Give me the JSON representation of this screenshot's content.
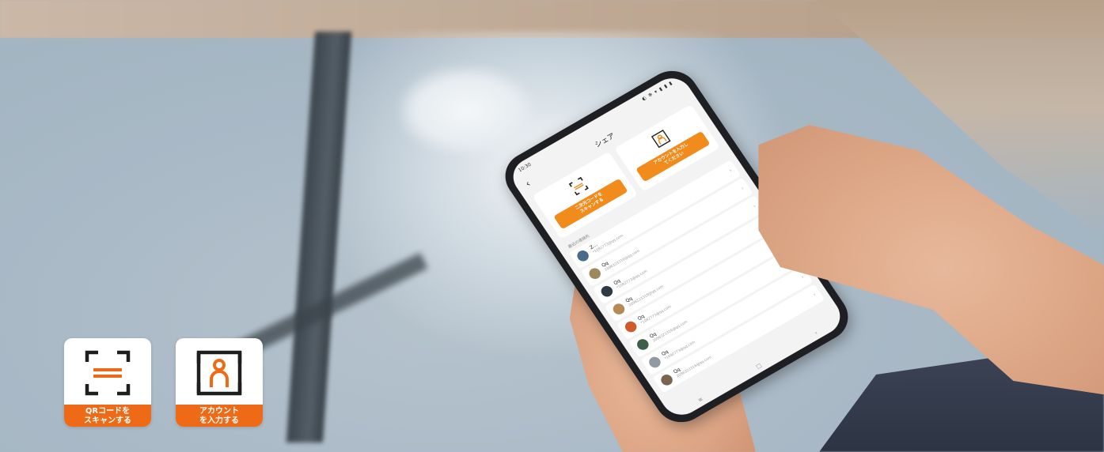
{
  "phone": {
    "status_time": "10:30",
    "status_icons": "◐ ✻ ▾ ▮ ▮ ▮",
    "back_icon": "chevron-left-icon",
    "title": "シェア",
    "scan_card_label": "二次元コードを\nスキャンする",
    "scan_card_icon": "qr-scan-icon",
    "account_card_label": "アカウントを入力し\nてください",
    "account_card_icon": "account-input-icon",
    "recent_label": "最近の連絡先",
    "contacts": [
      {
        "name": "Z...",
        "id": "*1092773@qq.com",
        "avatar_color": "#4a6a8a"
      },
      {
        "name": "Qq",
        "id": "2096323316@qq.com",
        "avatar_color": "#9c8a5a"
      },
      {
        "name": "Qq",
        "id": "*1092773@qq.com",
        "avatar_color": "#2e3b45"
      },
      {
        "name": "Qq",
        "id": "2096323316@qq.com",
        "avatar_color": "#b48a55"
      },
      {
        "name": "Qq",
        "id": "*1092773@qq.com",
        "avatar_color": "#d05a2a"
      },
      {
        "name": "Qq",
        "id": "2096323316@qq.com",
        "avatar_color": "#3f5f4a"
      },
      {
        "name": "Qq",
        "id": "*1092773@qq.com",
        "avatar_color": "#8f9aa3"
      },
      {
        "name": "Qq",
        "id": "2096323316@qq.com",
        "avatar_color": "#7a6550"
      }
    ],
    "bottom_nav": [
      "≡",
      "□",
      "‹"
    ]
  },
  "badges": {
    "qr": {
      "label": "QRコードを\nスキャンする",
      "icon": "qr-scan-icon"
    },
    "account": {
      "label": "アカウント\nを入力する",
      "icon": "account-input-icon"
    }
  },
  "colors": {
    "accent_orange": "#f08b1c",
    "badge_orange": "#ee6a17",
    "icon_dark": "#1e1e1e"
  }
}
